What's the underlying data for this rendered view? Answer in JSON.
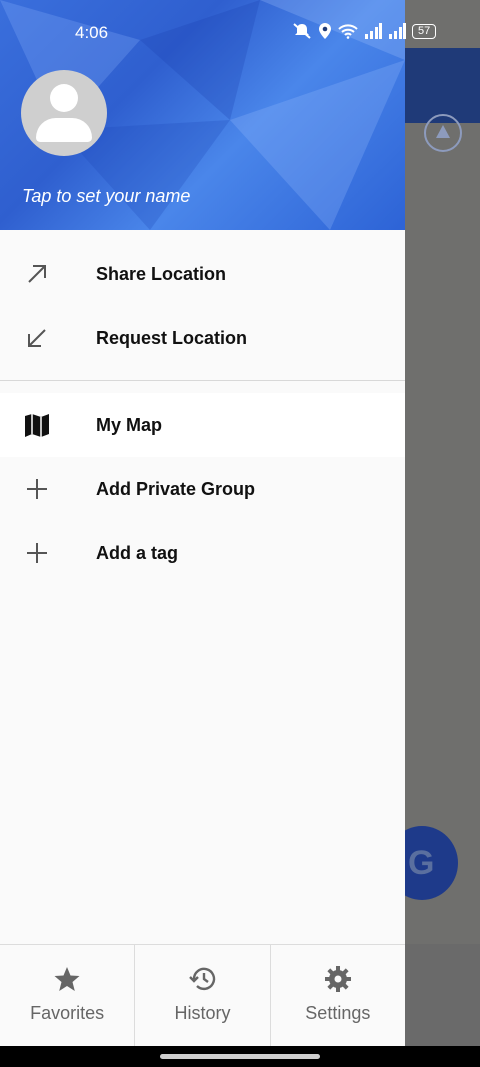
{
  "status_bar": {
    "time": "4:06",
    "battery": "57"
  },
  "drawer": {
    "header": {
      "name_prompt": "Tap to set your name"
    },
    "menu_top": [
      {
        "label": "Share Location",
        "icon": "arrow-up-right-icon"
      },
      {
        "label": "Request Location",
        "icon": "arrow-down-left-icon"
      }
    ],
    "menu_groups": [
      {
        "label": "My Map",
        "icon": "map-icon",
        "active": true
      },
      {
        "label": "Add Private Group",
        "icon": "plus-icon"
      },
      {
        "label": "Add a tag",
        "icon": "plus-icon"
      }
    ],
    "footer": [
      {
        "label": "Favorites",
        "icon": "star-icon"
      },
      {
        "label": "History",
        "icon": "history-icon"
      },
      {
        "label": "Settings",
        "icon": "gear-icon"
      }
    ]
  },
  "colors": {
    "header_blue": "#3a6fdc",
    "scrim": "#6f6f6d",
    "text": "#111111"
  }
}
